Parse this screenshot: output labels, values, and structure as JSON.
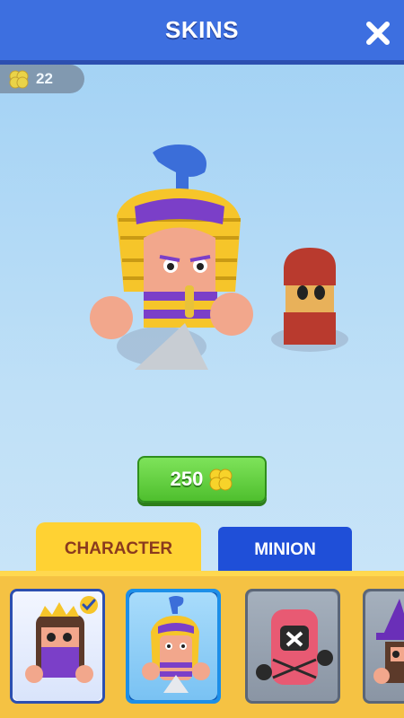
{
  "header": {
    "title": "SKINS",
    "close_icon": "close-icon"
  },
  "currency": {
    "icon": "clover-coin-icon",
    "amount": "22"
  },
  "purchase": {
    "price": "250",
    "icon": "clover-coin-icon"
  },
  "tabs": [
    {
      "label": "CHARACTER",
      "selected": true
    },
    {
      "label": "MINION",
      "selected": false
    }
  ],
  "skins": [
    {
      "name": "princess",
      "owned": true,
      "selected": false
    },
    {
      "name": "pharaoh",
      "owned": false,
      "selected": true
    },
    {
      "name": "masked-guard",
      "owned": false,
      "selected": false
    },
    {
      "name": "witch",
      "owned": false,
      "selected": false
    }
  ],
  "colors": {
    "header": "#3d6fe0",
    "tab_active": "#ffd233",
    "tab_inactive": "#1f4fd8",
    "buy_button": "#4fbf2e",
    "shelf": "#f5c243"
  }
}
